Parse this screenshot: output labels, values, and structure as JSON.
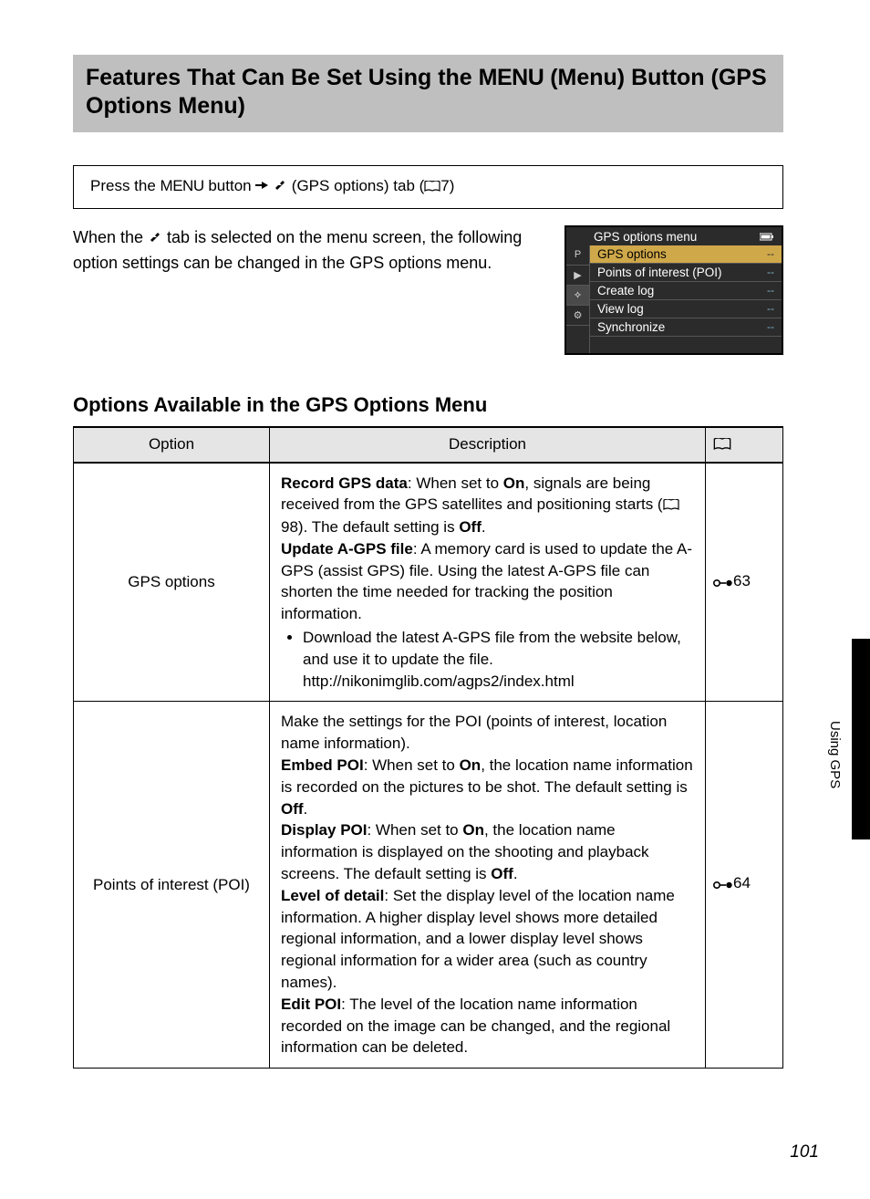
{
  "title": {
    "prefix": "Features That Can Be Set Using the ",
    "menu_word": "MENU",
    "suffix": " (Menu) Button (GPS Options Menu)"
  },
  "instruction": {
    "prefix": "Press the ",
    "menu_word": "MENU",
    "mid1": " button ",
    "mid2": " (GPS options) tab (",
    "page_ref": "7",
    "suffix": ")"
  },
  "body_text": {
    "l1a": "When the ",
    "l1b": " tab is selected on the menu screen, the following option settings can be changed in the GPS options menu."
  },
  "screen": {
    "title": "GPS options menu",
    "tabs": [
      "P",
      "▶",
      "✧",
      "⚙"
    ],
    "items": [
      {
        "label": "GPS options",
        "val": "--"
      },
      {
        "label": "Points of interest (POI)",
        "val": "--"
      },
      {
        "label": "Create log",
        "val": "--"
      },
      {
        "label": "View log",
        "val": "--"
      },
      {
        "label": "Synchronize",
        "val": "--"
      }
    ]
  },
  "subheading": "Options Available in the GPS Options Menu",
  "table": {
    "headers": {
      "option": "Option",
      "description": "Description"
    },
    "rows": [
      {
        "option": "GPS options",
        "ref": "63",
        "desc": {
          "d1a": "Record GPS data",
          "d1b": ": When set to ",
          "d1c": "On",
          "d1d": ", signals are being received from the GPS satellites and positioning starts (",
          "d1e": "98). The default setting is ",
          "d1f": "Off",
          "d1g": ".",
          "d2a": "Update A-GPS file",
          "d2b": ": A memory card is used to update the A-GPS (assist GPS) file. Using the latest A-GPS file can shorten the time needed for tracking the position information.",
          "bullet": "Download the latest A-GPS file from the website below, and use it to update the file.",
          "url": "http://nikonimglib.com/agps2/index.html"
        }
      },
      {
        "option": "Points of interest (POI)",
        "ref": "64",
        "desc": {
          "intro": "Make the settings for the POI (points of interest, location name information).",
          "e1a": "Embed POI",
          "e1b": ": When set to ",
          "e1c": "On",
          "e1d": ", the location name information is recorded on the pictures to be shot. The default setting is ",
          "e1e": "Off",
          "e1f": ".",
          "d1a": "Display POI",
          "d1b": ": When set to ",
          "d1c": "On",
          "d1d": ", the location name information is displayed on the shooting and playback screens. The default setting is ",
          "d1e": "Off",
          "d1f": ".",
          "l1a": "Level of detail",
          "l1b": ": Set the display level of the location name information. A higher display level shows more detailed regional information, and a lower display level shows regional information for a wider area (such as country names).",
          "p1a": "Edit POI",
          "p1b": ": The level of the location name information recorded on the image can be changed, and the regional information can be deleted."
        }
      }
    ]
  },
  "side_label": "Using GPS",
  "page_number": "101"
}
